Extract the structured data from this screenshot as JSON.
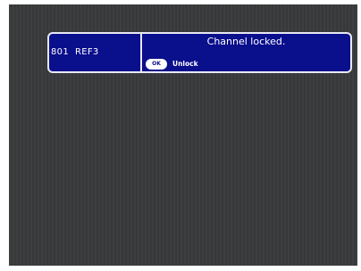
{
  "channel": {
    "number": "801",
    "name": "REF3"
  },
  "message": {
    "title": "Channel locked."
  },
  "actions": {
    "ok_key_label": "OK",
    "unlock_label": "Unlock"
  },
  "colors": {
    "osd_background": "#0a0f8c",
    "osd_border": "#e8e8f4",
    "screen_background": "#383a3b"
  }
}
